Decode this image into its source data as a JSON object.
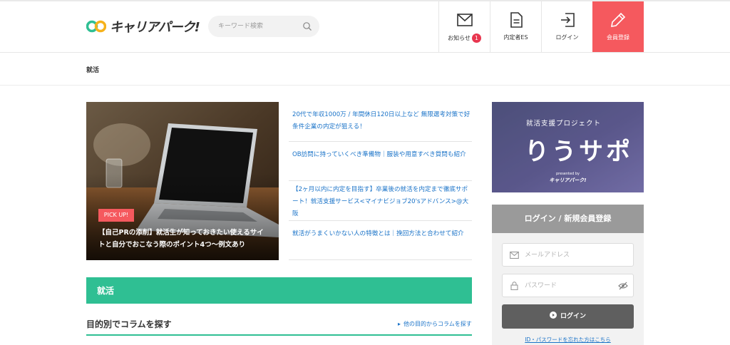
{
  "header": {
    "logo_text": "キャリアパーク!",
    "search_placeholder": "キーワード検索",
    "nav": {
      "notifications_label": "お知らせ",
      "notifications_count": "1",
      "es_label": "内定者ES",
      "login_label": "ログイン",
      "register_label": "会員登録"
    }
  },
  "breadcrumb": {
    "current": "就活"
  },
  "pickup": {
    "badge": "PICK UP!",
    "title": "【自己PRの添削】就活生が知っておきたい使えるサイトと自分でおこなう際のポイント4つ〜例文あり"
  },
  "articles": [
    {
      "title": "20代で年収1000万 / 年間休日120日以上など 無限選考対策で好条件企業の内定が狙える！"
    },
    {
      "title": "OB訪問に持っていくべき準備物｜服装や用意すべき質問も紹介"
    },
    {
      "title": "【2ヶ月以内に内定を目指す】卒業後の就活を内定まで徹底サポート！就活支援サービス<マイナビジョブ20'sアドバンス>@大阪"
    },
    {
      "title": "就活がうまくいかない人の特徴とは｜挽回方法と合わせて紹介"
    }
  ],
  "section": {
    "heading": "就活",
    "purpose_title": "目的別でコラムを探す",
    "purpose_link": "他の目的からコラムを探す"
  },
  "banner": {
    "subtitle": "就活支援プロジェクト",
    "title": "りうサポ",
    "presented_by": "presented by",
    "brand": "キャリアパーク!"
  },
  "login": {
    "heading": "ログイン / 新規会員登録",
    "email_placeholder": "メールアドレス",
    "password_placeholder": "パスワード",
    "button": "ログイン",
    "forgot": "ID・パスワードを忘れた方はこちら"
  },
  "colors": {
    "accent_red": "#f5595e",
    "green": "#2fbf93",
    "link_blue": "#1a73c8"
  }
}
